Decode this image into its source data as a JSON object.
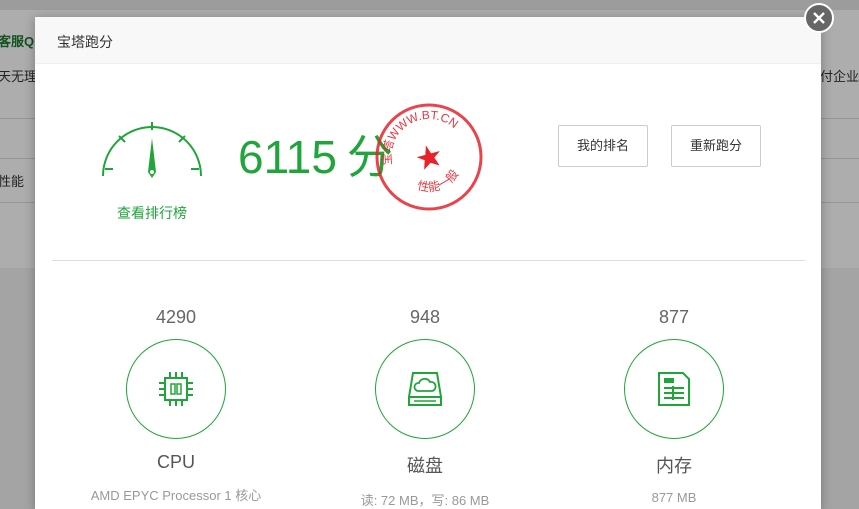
{
  "background": {
    "left_top_text": "客服Q",
    "left_row_text": "天无理由",
    "right_row_text": "付企业",
    "left_row2_text": "性能"
  },
  "dialog": {
    "title": "宝塔跑分",
    "rank_link": "查看排行榜",
    "score_value": "6115",
    "score_unit": "分",
    "stamp": {
      "top_text": "宝塔WWW.BT.CN",
      "bottom_text": "性能一般"
    },
    "buttons": {
      "my_rank": "我的排名",
      "retest": "重新跑分"
    },
    "metrics": [
      {
        "value": "4290",
        "name": "CPU",
        "detail": "AMD EPYC Processor 1 核心",
        "icon": "cpu-icon"
      },
      {
        "value": "948",
        "name": "磁盘",
        "detail": "读: 72 MB，写: 86 MB",
        "icon": "disk-icon"
      },
      {
        "value": "877",
        "name": "内存",
        "detail": "877 MB",
        "icon": "memory-icon"
      }
    ]
  },
  "colors": {
    "accent": "#20a53a",
    "stamp_red": "#e8222b"
  }
}
